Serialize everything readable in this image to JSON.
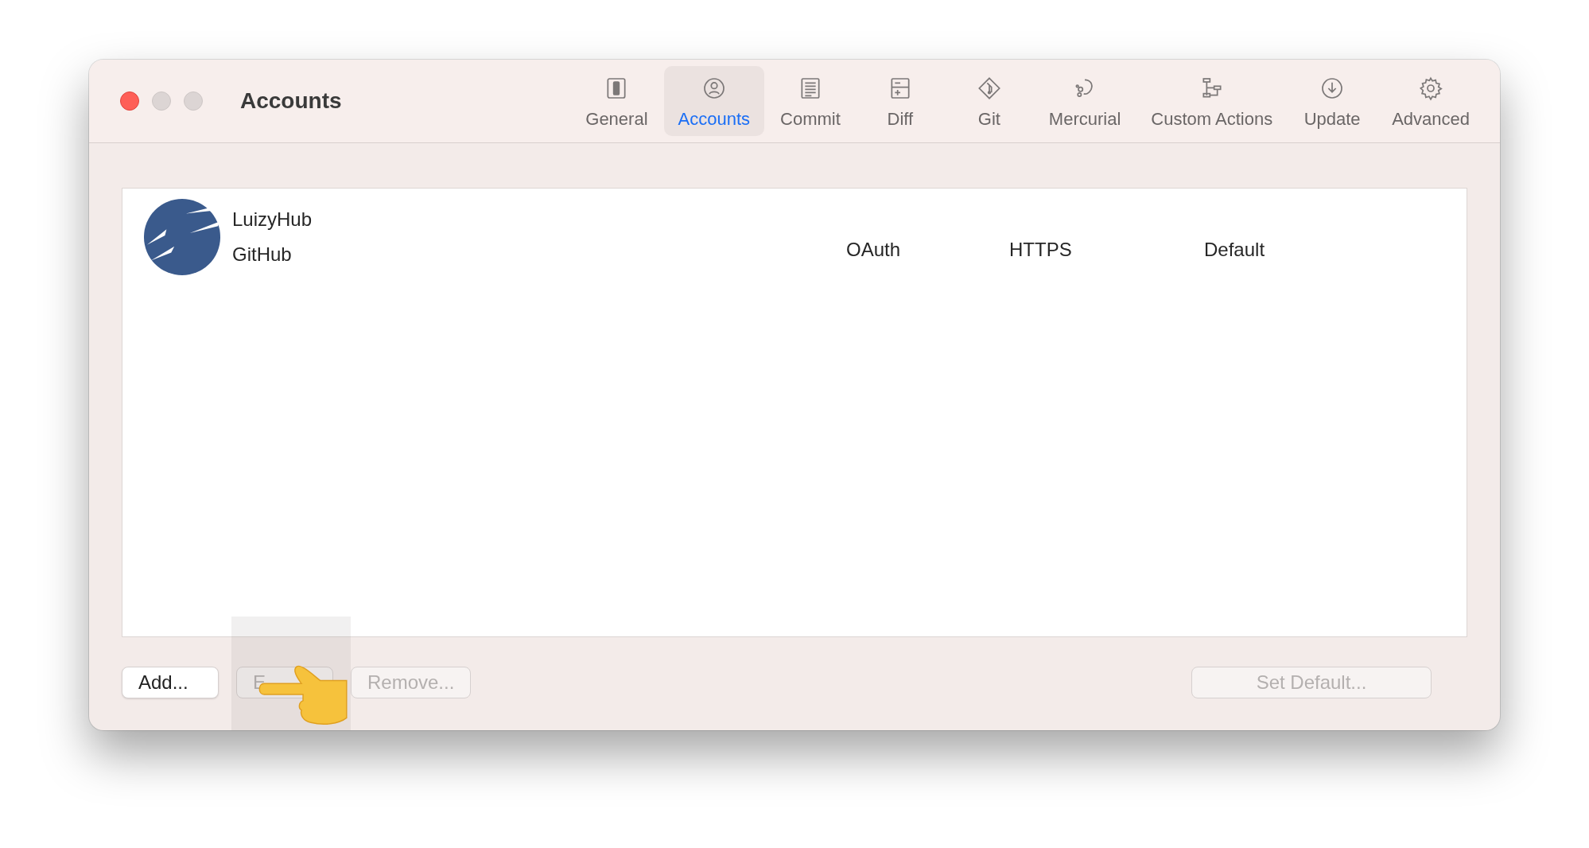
{
  "window": {
    "title": "Accounts"
  },
  "toolbar": [
    {
      "label": "General",
      "kind": "switch",
      "selected": false
    },
    {
      "label": "Accounts",
      "kind": "person",
      "selected": true
    },
    {
      "label": "Commit",
      "kind": "document",
      "selected": false
    },
    {
      "label": "Diff",
      "kind": "diff",
      "selected": false
    },
    {
      "label": "Git",
      "kind": "git",
      "selected": false
    },
    {
      "label": "Mercurial",
      "kind": "mercurial",
      "selected": false
    },
    {
      "label": "Custom Actions",
      "kind": "tree",
      "selected": false
    },
    {
      "label": "Update",
      "kind": "download",
      "selected": false
    },
    {
      "label": "Advanced",
      "kind": "gear",
      "selected": false
    }
  ],
  "accounts": [
    {
      "name": "LuizyHub",
      "host": "GitHub",
      "auth": "OAuth",
      "protocol": "HTTPS",
      "status": "Default"
    }
  ],
  "buttons_left": [
    {
      "label": "Add...",
      "disabled": false
    },
    {
      "label": "E",
      "disabled": true
    },
    {
      "label": "Remove...",
      "disabled": true
    }
  ],
  "buttons_right": [
    {
      "label": "Set Default...",
      "disabled": true
    }
  ]
}
